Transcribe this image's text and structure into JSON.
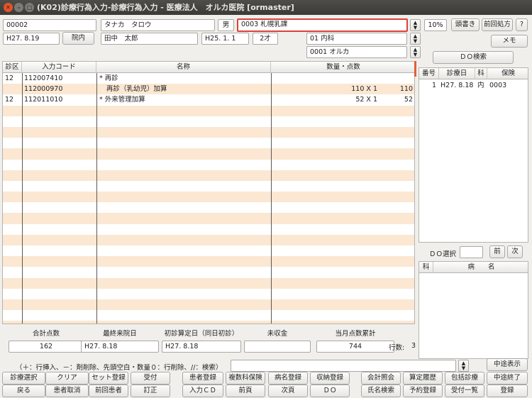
{
  "window": {
    "title": "(K02)診療行為入力-診療行為入力 - 医療法人　オルカ医院 [ormaster]"
  },
  "patient": {
    "id": "00002",
    "kana": "タナカ　タロウ",
    "sex": "男",
    "insurance": "0003 札幌乳課",
    "rate": "10%",
    "visit_date": "H27. 8.19",
    "inpatient_button": "院内",
    "name": "田中　太郎",
    "birth": "H25. 1. 1",
    "age": "2才",
    "department": "01 内科",
    "doctor": "0001 オルカ"
  },
  "top_buttons": {
    "header": "頭書き",
    "prev_rx": "前回処方",
    "help": "?",
    "memo": "メモ",
    "do_search": "ＤＯ検索"
  },
  "grid": {
    "headers": [
      "診区",
      "入力コード",
      "名称",
      "数量・点数"
    ],
    "rows": [
      {
        "ku": "12",
        "code": "112007410",
        "name": "* 再診",
        "qty": "",
        "pts": ""
      },
      {
        "ku": "",
        "code": "112000970",
        "name": "再診（乳幼児）加算",
        "qty": "110 X 1",
        "pts": "110"
      },
      {
        "ku": "12",
        "code": "112011010",
        "name": "* 外来管理加算",
        "qty": "52 X 1",
        "pts": "52"
      }
    ]
  },
  "history": {
    "headers": [
      "番号",
      "診療日",
      "科",
      "保険"
    ],
    "rows": [
      {
        "no": "1",
        "date": "H27. 8.18",
        "ka": "内",
        "hoken": "0003"
      }
    ]
  },
  "do_select": {
    "label": "ＤＯ選択",
    "prev": "前",
    "next": "次",
    "headers": [
      "科",
      "病　　名"
    ]
  },
  "totals": {
    "labels": [
      "合計点数",
      "最終来院日",
      "初診算定日（同日初診）",
      "未収金",
      "当月点数累計"
    ],
    "values": [
      "162",
      "H27. 8.18",
      "H27. 8.18",
      "",
      "744"
    ],
    "rows_label": "行数:",
    "rows_value": "3"
  },
  "hint": "（＋：行挿入、－：剤削除、先頭空白・数量０：行削除、//：検索）",
  "interrupt_display": "中途表示",
  "function_buttons": {
    "row1": [
      "診療選択",
      "クリア",
      "セット登録",
      "受付",
      "患者登録",
      "複数科保険",
      "病名登録",
      "収納登録",
      "会計照会",
      "算定履歴",
      "包括診療",
      "中途終了"
    ],
    "row2": [
      "戻る",
      "患者取消",
      "前回患者",
      "訂正",
      "入力ＣＤ",
      "前頁",
      "次頁",
      "ＤＯ",
      "氏名検索",
      "予約登録",
      "受付一覧",
      "登録"
    ]
  }
}
